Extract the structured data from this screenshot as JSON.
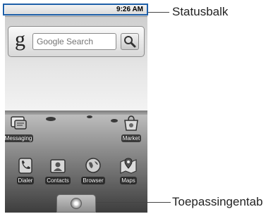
{
  "status_bar": {
    "time": "9:26 AM"
  },
  "search_widget": {
    "logo": "g",
    "placeholder": "Google Search"
  },
  "shortcuts": [
    {
      "label": "Messaging",
      "icon": "messaging-icon"
    },
    {
      "label": "Market",
      "icon": "market-icon"
    }
  ],
  "dock": [
    {
      "label": "Dialer",
      "icon": "dialer-icon"
    },
    {
      "label": "Contacts",
      "icon": "contacts-icon"
    },
    {
      "label": "Browser",
      "icon": "browser-icon"
    },
    {
      "label": "Maps",
      "icon": "maps-icon"
    }
  ],
  "callouts": {
    "status_bar": "Statusbalk",
    "app_drawer": "Toepassingentab"
  },
  "colors": {
    "highlight": "#1e5fa8"
  }
}
